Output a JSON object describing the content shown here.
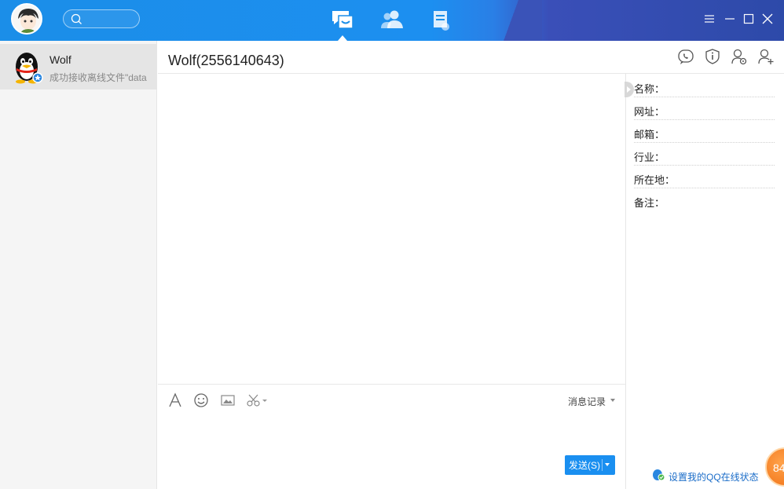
{
  "topbar": {
    "search_placeholder": "",
    "nav_tabs": [
      {
        "name": "messages",
        "active": true
      },
      {
        "name": "contacts",
        "active": false
      },
      {
        "name": "groups",
        "active": false
      }
    ],
    "window_controls": [
      "menu",
      "minimize",
      "maximize",
      "close"
    ]
  },
  "contacts": [
    {
      "name": "Wolf",
      "last_message": "成功接收离线文件\"data"
    }
  ],
  "chat": {
    "title": "Wolf(2556140643)",
    "header_icons": [
      "phone-icon",
      "info-icon",
      "add-friend-settings-icon",
      "add-user-icon"
    ],
    "toolbar": {
      "history_label": "消息记录"
    },
    "send_label": "发送(S)"
  },
  "info_panel": {
    "fields": [
      {
        "label": "名称："
      },
      {
        "label": "网址："
      },
      {
        "label": "邮箱："
      },
      {
        "label": "行业："
      },
      {
        "label": "所在地："
      },
      {
        "label": "备注："
      }
    ],
    "status_link": "设置我的QQ在线状态",
    "badge": "84"
  },
  "colors": {
    "accent": "#1a8ff0",
    "topbar_dark": "#3a53b8"
  }
}
